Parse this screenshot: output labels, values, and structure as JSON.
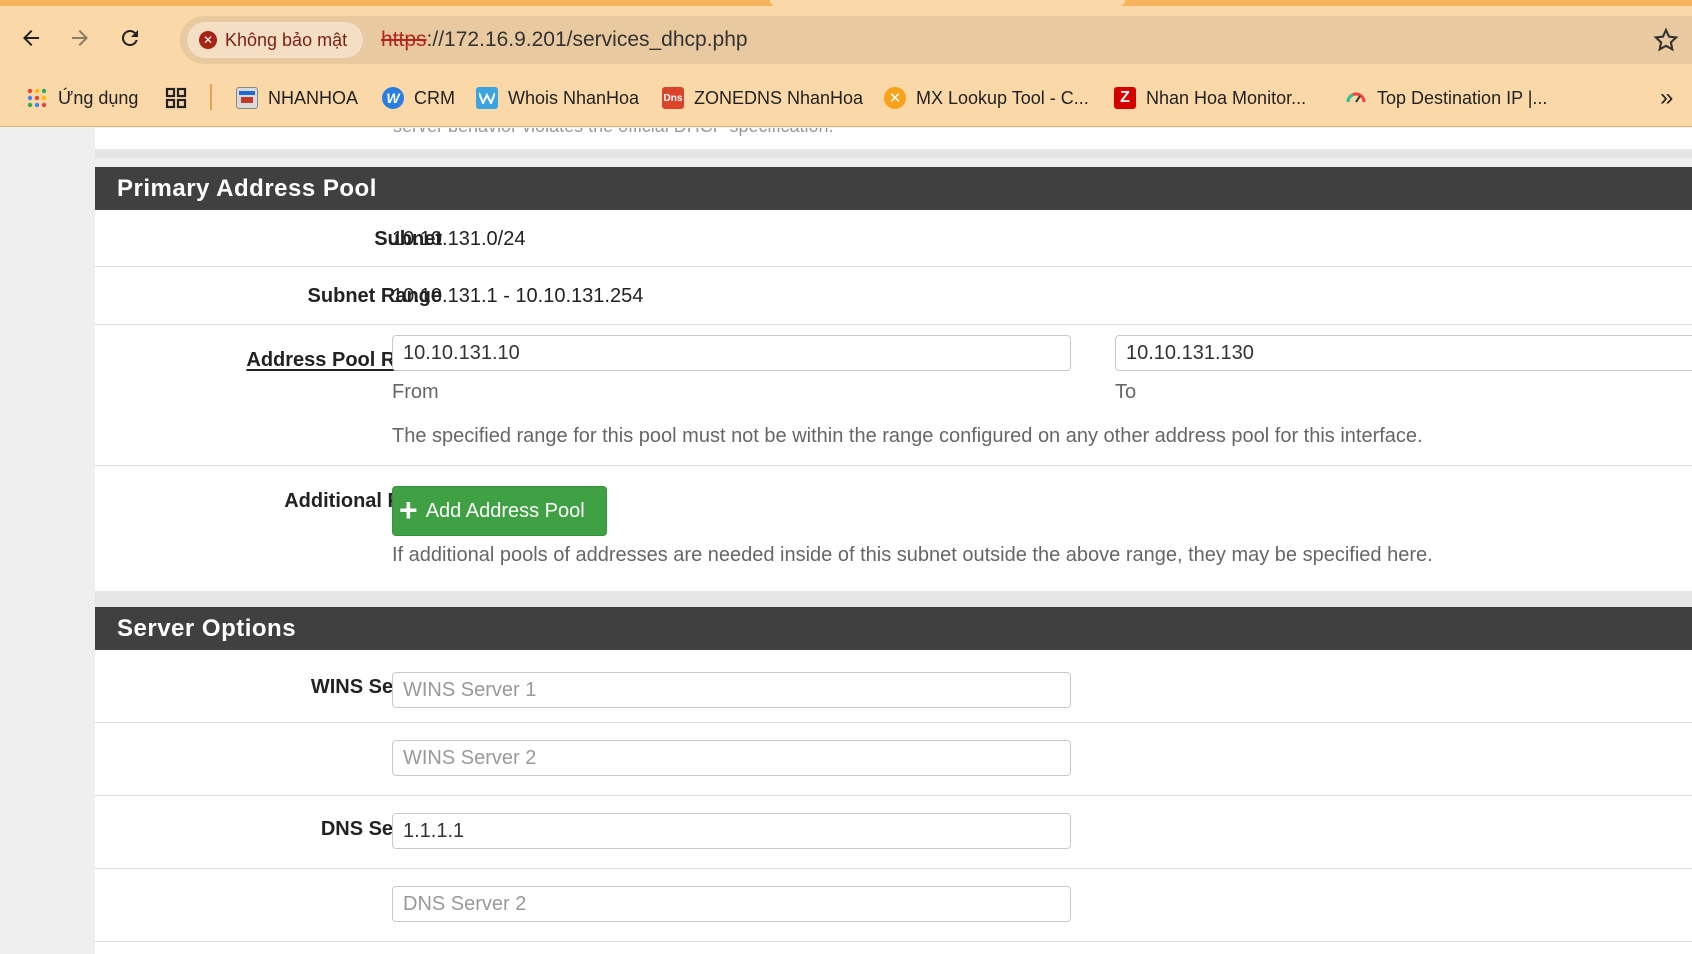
{
  "browser": {
    "security_label": "Không bảo mật",
    "url_scheme": "https",
    "url_rest": "://172.16.9.201/services_dhcp.php",
    "bookmarks": [
      {
        "label": "Ứng dụng",
        "icon": "apps-grid-icon"
      },
      {
        "label": "",
        "icon": "tab-groups-icon"
      },
      {
        "label": "NHANHOA",
        "icon": "nhanhoa-icon"
      },
      {
        "label": "CRM",
        "icon": "crm-w-icon"
      },
      {
        "label": "Whois NhanHoa",
        "icon": "whois-icon"
      },
      {
        "label": "ZONEDNS NhanHoa",
        "icon": "dns-icon"
      },
      {
        "label": "MX Lookup Tool - C...",
        "icon": "mx-icon"
      },
      {
        "label": "Nhan Hoa Monitor...",
        "icon": "zabbix-z-icon"
      },
      {
        "label": "Top Destination IP |...",
        "icon": "gauge-icon"
      }
    ],
    "overflow_label": "»"
  },
  "page": {
    "clipped_text": "server behavior violates the official DHCP specification.",
    "primary_pool": {
      "title": "Primary Address Pool",
      "subnet_label": "Subnet",
      "subnet_value": "10.10.131.0/24",
      "subnet_range_label": "Subnet Range",
      "subnet_range_value": "10.10.131.1 - 10.10.131.254",
      "pool_range_label": "Address Pool Range",
      "from_value": "10.10.131.10",
      "to_value": "10.10.131.130",
      "from_help": "From",
      "to_help": "To",
      "range_help": "The specified range for this pool must not be within the range configured on any other address pool for this interface.",
      "additional_label": "Additional Pools",
      "add_button": "Add Address Pool",
      "additional_help": "If additional pools of addresses are needed inside of this subnet outside the above range, they may be specified here."
    },
    "server_options": {
      "title": "Server Options",
      "wins_label": "WINS Servers",
      "wins1_placeholder": "WINS Server 1",
      "wins2_placeholder": "WINS Server 2",
      "dns_label": "DNS Servers",
      "dns1_value": "1.1.1.1",
      "dns2_placeholder": "DNS Server 2"
    }
  },
  "colors": {
    "header_bg": "#404040",
    "button_green": "#3fa143",
    "chrome_bg": "#fbd8a8",
    "insecure_red": "#b3261e"
  }
}
